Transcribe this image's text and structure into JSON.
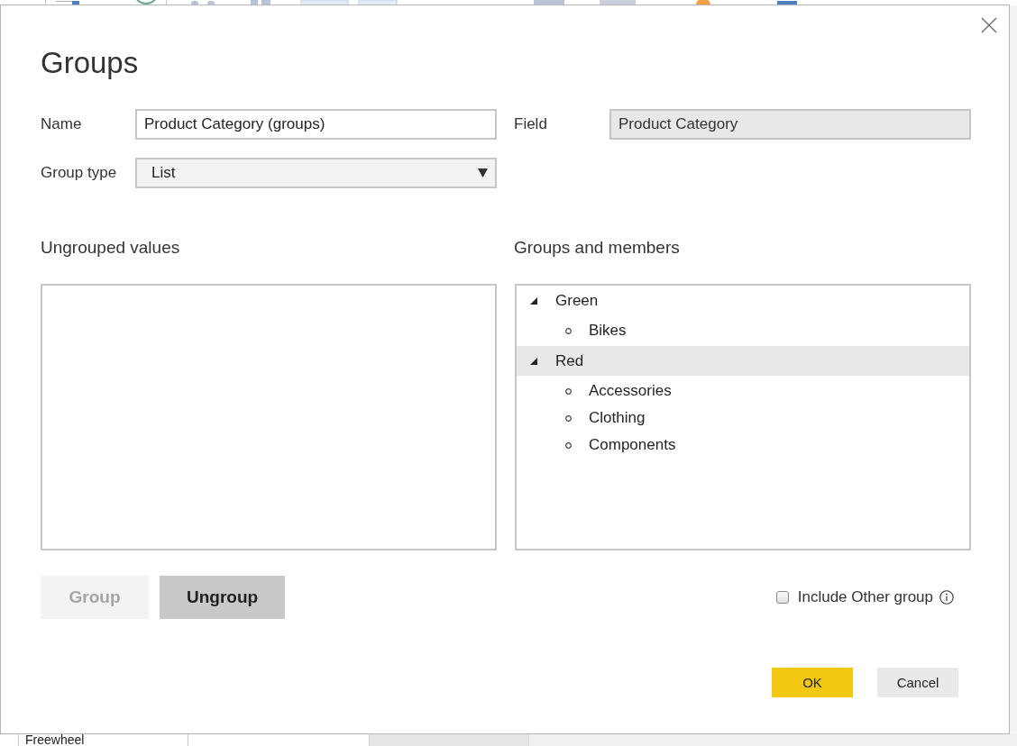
{
  "background": {
    "table_cell": "Freewheel"
  },
  "dialog": {
    "title": "Groups",
    "name": {
      "label": "Name",
      "value": "Product Category (groups)"
    },
    "field": {
      "label": "Field",
      "value": "Product Category",
      "disabled": true
    },
    "group_type": {
      "label": "Group type",
      "value": "List"
    },
    "ungrouped_values": {
      "heading": "Ungrouped values"
    },
    "groups_and_members": {
      "heading": "Groups and members",
      "groups": [
        {
          "label": "Green",
          "expanded": true,
          "selected": false,
          "children": [
            {
              "label": "Bikes",
              "selected": false
            }
          ]
        },
        {
          "label": "Red",
          "expanded": true,
          "selected": true,
          "children": [
            {
              "label": "Accessories",
              "selected": false
            },
            {
              "label": "Clothing",
              "selected": false
            },
            {
              "label": "Components",
              "selected": false
            }
          ]
        }
      ]
    },
    "group_buttons": [
      {
        "label": "Group",
        "disabled": true
      },
      {
        "label": "Ungroup",
        "disabled": false
      }
    ],
    "include_other_group": {
      "label": "Include Other group",
      "checked": false
    },
    "footer_buttons": [
      {
        "label": "OK",
        "kind": "primary"
      },
      {
        "label": "Cancel",
        "kind": "secondary"
      }
    ]
  }
}
